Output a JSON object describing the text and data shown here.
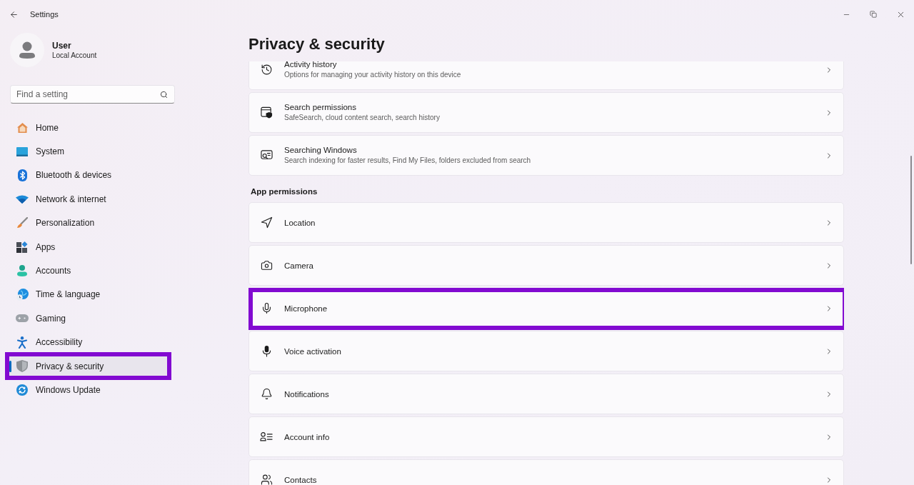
{
  "window": {
    "title": "Settings"
  },
  "account": {
    "name": "User",
    "type": "Local Account"
  },
  "search": {
    "placeholder": "Find a setting"
  },
  "navigation": [
    {
      "label": "Home",
      "selected": false,
      "highlighted": false
    },
    {
      "label": "System",
      "selected": false,
      "highlighted": false
    },
    {
      "label": "Bluetooth & devices",
      "selected": false,
      "highlighted": false
    },
    {
      "label": "Network & internet",
      "selected": false,
      "highlighted": false
    },
    {
      "label": "Personalization",
      "selected": false,
      "highlighted": false
    },
    {
      "label": "Apps",
      "selected": false,
      "highlighted": false
    },
    {
      "label": "Accounts",
      "selected": false,
      "highlighted": false
    },
    {
      "label": "Time & language",
      "selected": false,
      "highlighted": false
    },
    {
      "label": "Gaming",
      "selected": false,
      "highlighted": false
    },
    {
      "label": "Accessibility",
      "selected": false,
      "highlighted": false
    },
    {
      "label": "Privacy & security",
      "selected": true,
      "highlighted": true
    },
    {
      "label": "Windows Update",
      "selected": false,
      "highlighted": false
    }
  ],
  "page": {
    "title": "Privacy & security",
    "groups": [
      {
        "items": [
          {
            "title": "Activity history",
            "description": "Options for managing your activity history on this device",
            "highlighted": false
          },
          {
            "title": "Search permissions",
            "description": "SafeSearch, cloud content search, search history",
            "highlighted": false
          },
          {
            "title": "Searching Windows",
            "description": "Search indexing for faster results, Find My Files, folders excluded from search",
            "highlighted": false
          }
        ]
      },
      {
        "heading": "App permissions",
        "items": [
          {
            "title": "Location",
            "highlighted": false
          },
          {
            "title": "Camera",
            "highlighted": false
          },
          {
            "title": "Microphone",
            "highlighted": true
          },
          {
            "title": "Voice activation",
            "highlighted": false
          },
          {
            "title": "Notifications",
            "highlighted": false
          },
          {
            "title": "Account info",
            "highlighted": false
          },
          {
            "title": "Contacts",
            "highlighted": false
          }
        ]
      }
    ]
  }
}
